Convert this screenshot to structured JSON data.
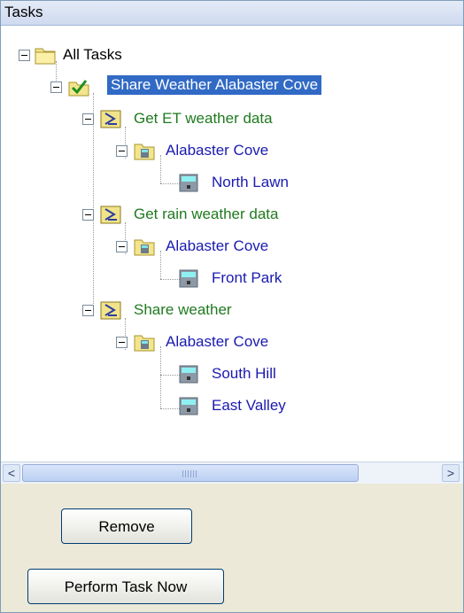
{
  "panel": {
    "title": "Tasks"
  },
  "tree": {
    "root": {
      "label": "All Tasks"
    },
    "selected_task": {
      "label": "Share Weather Alabaster Cove"
    },
    "groups": [
      {
        "label": "Get ET weather data",
        "site": "Alabaster Cove",
        "stations": [
          "North Lawn"
        ]
      },
      {
        "label": "Get rain weather data",
        "site": "Alabaster Cove",
        "stations": [
          "Front Park"
        ]
      },
      {
        "label": "Share weather",
        "site": "Alabaster Cove",
        "stations": [
          "South Hill",
          "East Valley"
        ]
      }
    ]
  },
  "scrollbar": {
    "left_arrow": "<",
    "right_arrow": ">"
  },
  "buttons": {
    "remove": "Remove",
    "perform": "Perform Task Now"
  },
  "colors": {
    "selection": "#316ac5",
    "task_text": "#1f7a1f",
    "station_text": "#1a1ab0"
  }
}
